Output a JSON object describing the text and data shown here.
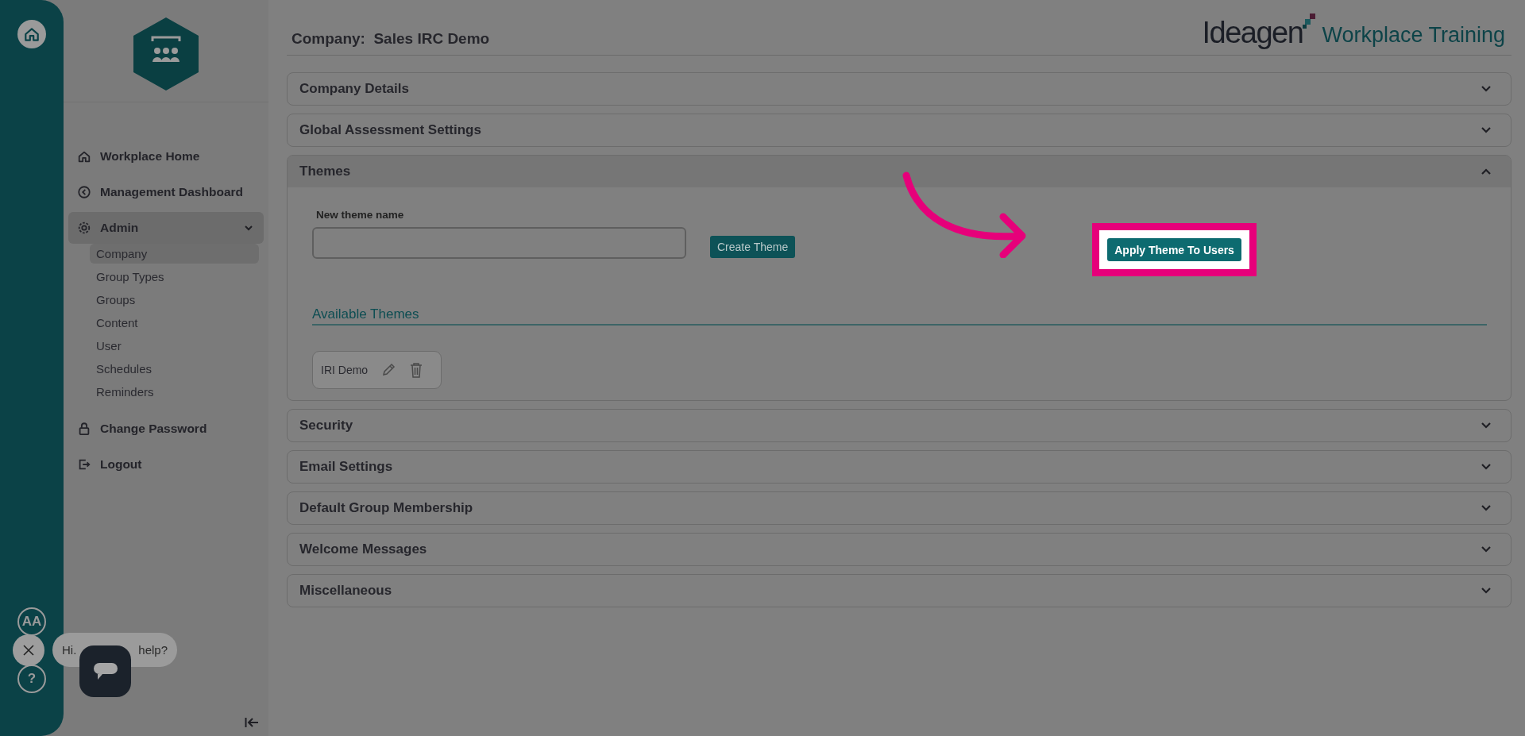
{
  "rail": {
    "accessibility_label": "AA",
    "help_label": "?"
  },
  "sidebar": {
    "items": [
      {
        "label": "Workplace Home",
        "selected": false
      },
      {
        "label": "Management Dashboard",
        "selected": false
      },
      {
        "label": "Admin",
        "selected": true,
        "expanded": true,
        "children": [
          {
            "label": "Company",
            "selected": true
          },
          {
            "label": "Group Types",
            "selected": false
          },
          {
            "label": "Groups",
            "selected": false
          },
          {
            "label": "Content",
            "selected": false
          },
          {
            "label": "User",
            "selected": false
          },
          {
            "label": "Schedules",
            "selected": false
          },
          {
            "label": "Reminders",
            "selected": false
          }
        ]
      },
      {
        "label": "Change Password",
        "selected": false
      },
      {
        "label": "Logout",
        "selected": false
      }
    ]
  },
  "header": {
    "title_label": "Company:",
    "title_value": "Sales IRC Demo",
    "logo_wordmark": "Ideagen",
    "product": "Workplace Training"
  },
  "sections": [
    {
      "title": "Company Details",
      "expanded": false
    },
    {
      "title": "Global Assessment Settings",
      "expanded": false
    },
    {
      "title": "Themes",
      "expanded": true,
      "body": {
        "new_theme_label": "New theme name",
        "create_button": "Create Theme",
        "apply_button": "Apply Theme To Users",
        "available_heading": "Available Themes",
        "themes": [
          {
            "name": "IRI Demo"
          }
        ]
      }
    },
    {
      "title": "Security",
      "expanded": false
    },
    {
      "title": "Email Settings",
      "expanded": false
    },
    {
      "title": "Default Group Membership",
      "expanded": false
    },
    {
      "title": "Welcome Messages",
      "expanded": false
    },
    {
      "title": "Miscellaneous",
      "expanded": false
    }
  ],
  "chat": {
    "message_parts": [
      "Hi.",
      "help?"
    ]
  }
}
